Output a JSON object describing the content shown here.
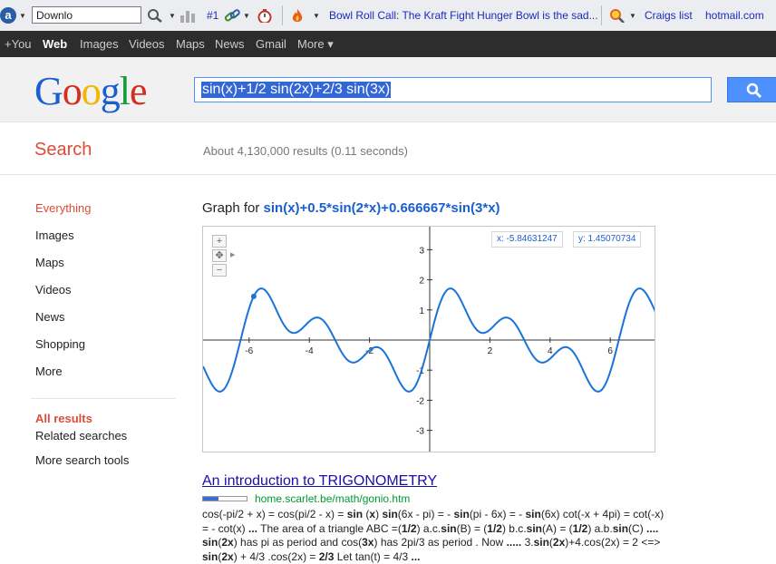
{
  "toolbar": {
    "address_text": "Downlo",
    "rank_label": "#1",
    "news_link": "Bowl Roll Call: The Kraft Fight Hunger Bowl is the sad...",
    "bookmark_craigslist": "Craigs list",
    "bookmark_hotmail": "hotmail.com"
  },
  "gbar": {
    "items": [
      "+You",
      "Web",
      "Images",
      "Videos",
      "Maps",
      "News",
      "Gmail",
      "More ▾"
    ]
  },
  "header": {
    "logo": "Google",
    "query": "sin(x)+1/2 sin(2x)+2/3 sin(3x)",
    "colors": {
      "accent_blue": "#4d90fe",
      "search_red": "#dd4b39"
    }
  },
  "results": {
    "heading": "Search",
    "stats": "About 4,130,000 results (0.11 seconds)"
  },
  "sidebar": {
    "items": [
      "Everything",
      "Images",
      "Maps",
      "Videos",
      "News",
      "Shopping",
      "More"
    ],
    "tools": [
      "All results",
      "Related searches",
      "More search tools"
    ]
  },
  "graph": {
    "title_prefix": "Graph for",
    "expression": "sin(x)+0.5*sin(2*x)+0.666667*sin(3*x)",
    "coord_x": "x: -5.84631247",
    "coord_y": "y: 1.45070734",
    "zoom_in": "+",
    "zoom_out": "−",
    "pan": "✥"
  },
  "chart_data": {
    "type": "line",
    "function": "sin(x)+0.5*sin(2*x)+0.666667*sin(3*x)",
    "xlim": [
      -7.5,
      7.5
    ],
    "ylim": [
      -3.75,
      3.75
    ],
    "x_ticks": [
      -6,
      -4,
      -2,
      2,
      4,
      6
    ],
    "y_ticks": [
      -3,
      -2,
      -1,
      1,
      2,
      3
    ],
    "marker": {
      "x": -5.84631247,
      "y": 1.45070734
    },
    "line_color": "#1a73d6"
  },
  "result": {
    "title": "An introduction to TRIGONOMETRY",
    "url": "home.scarlet.be/math/gonio.htm",
    "snippet_html": "cos(-pi/2 + x) = cos(pi/2 - x) = <b>sin</b> (<b>x</b>) <b>sin</b>(6x - pi) = - <b>sin</b>(pi - 6x) = - <b>sin</b>(6x) cot(-x + 4pi) = cot(-x) = - cot(x) <b>...</b> The area of a triangle ABC =(<b>1/2</b>) a.c.<b>sin</b>(B) = (<b>1/2</b>) b.c.<b>sin</b>(A) = (<b>1/2</b>) a.b.<b>sin</b>(C) <b>....</b> <b>sin</b>(<b>2x</b>) has pi as period and cos(<b>3x</b>) has 2pi/3 as period . Now <b>.....</b> 3.<b>sin</b>(<b>2x</b>)+4.cos(2x) = 2 &lt;=&gt; <b>sin</b>(<b>2x</b>) + 4/3 .cos(2x) = <b>2/3</b> Let tan(t) = 4/3 <b>...</b>"
  }
}
